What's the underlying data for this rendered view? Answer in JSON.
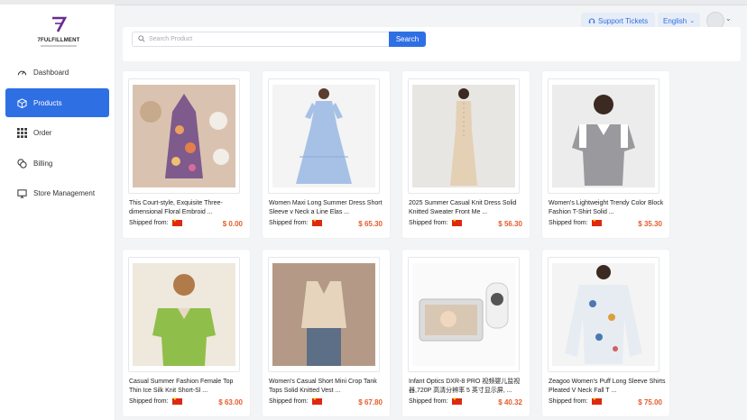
{
  "sidebar": {
    "logo_text": "7FULFILLMENT",
    "items": [
      {
        "label": "Dashboard",
        "icon": "speedometer-icon"
      },
      {
        "label": "Products",
        "icon": "box-icon",
        "active": true
      },
      {
        "label": "Order",
        "icon": "grid-icon"
      },
      {
        "label": "Billing",
        "icon": "coins-icon"
      },
      {
        "label": "Store Management",
        "icon": "store-icon"
      }
    ]
  },
  "header": {
    "support_label": "Support Tickets",
    "language": "English"
  },
  "search": {
    "placeholder": "Search Product",
    "button_label": "Search"
  },
  "products": [
    {
      "title": "This Court-style, Exquisite Three-dimensional Floral Embroid ...",
      "ship_label": "Shipped from:",
      "price": "$ 0.00"
    },
    {
      "title": "Women Maxi Long Summer Dress Short Sleeve v Neck a Line Elas ...",
      "ship_label": "Shipped from:",
      "price": "$ 65.30"
    },
    {
      "title": "2025 Summer Casual Knit Dress Solid Knitted Sweater Front Me ...",
      "ship_label": "Shipped from:",
      "price": "$ 56.30"
    },
    {
      "title": "Women's Lightweight Trendy Color Block Fashion T-Shirt Solid ...",
      "ship_label": "Shipped from:",
      "price": "$ 35.30"
    },
    {
      "title": "Casual Summer Fashion Female Top Thin Ice Silk Knit Short-Sl ...",
      "ship_label": "Shipped from:",
      "price": "$ 63.00"
    },
    {
      "title": "Women's Casual Short Mini Crop Tank Tops Solid Knitted Vest ...",
      "ship_label": "Shipped from:",
      "price": "$ 67.80"
    },
    {
      "title": "Infant Optics DXR-8 PRO 视频婴儿监视器,720P 高清分辨率 5 英寸显示屏, ...",
      "ship_label": "Shipped from:",
      "price": "$ 40.32"
    },
    {
      "title": "Zeagoo Women's Puff Long Sleeve Shirts Pleated V Neck Fall T ...",
      "ship_label": "Shipped from:",
      "price": "$ 75.00"
    }
  ],
  "colors": {
    "accent": "#2f6fe4",
    "price": "#e45d2b",
    "flag": "#de2910"
  }
}
